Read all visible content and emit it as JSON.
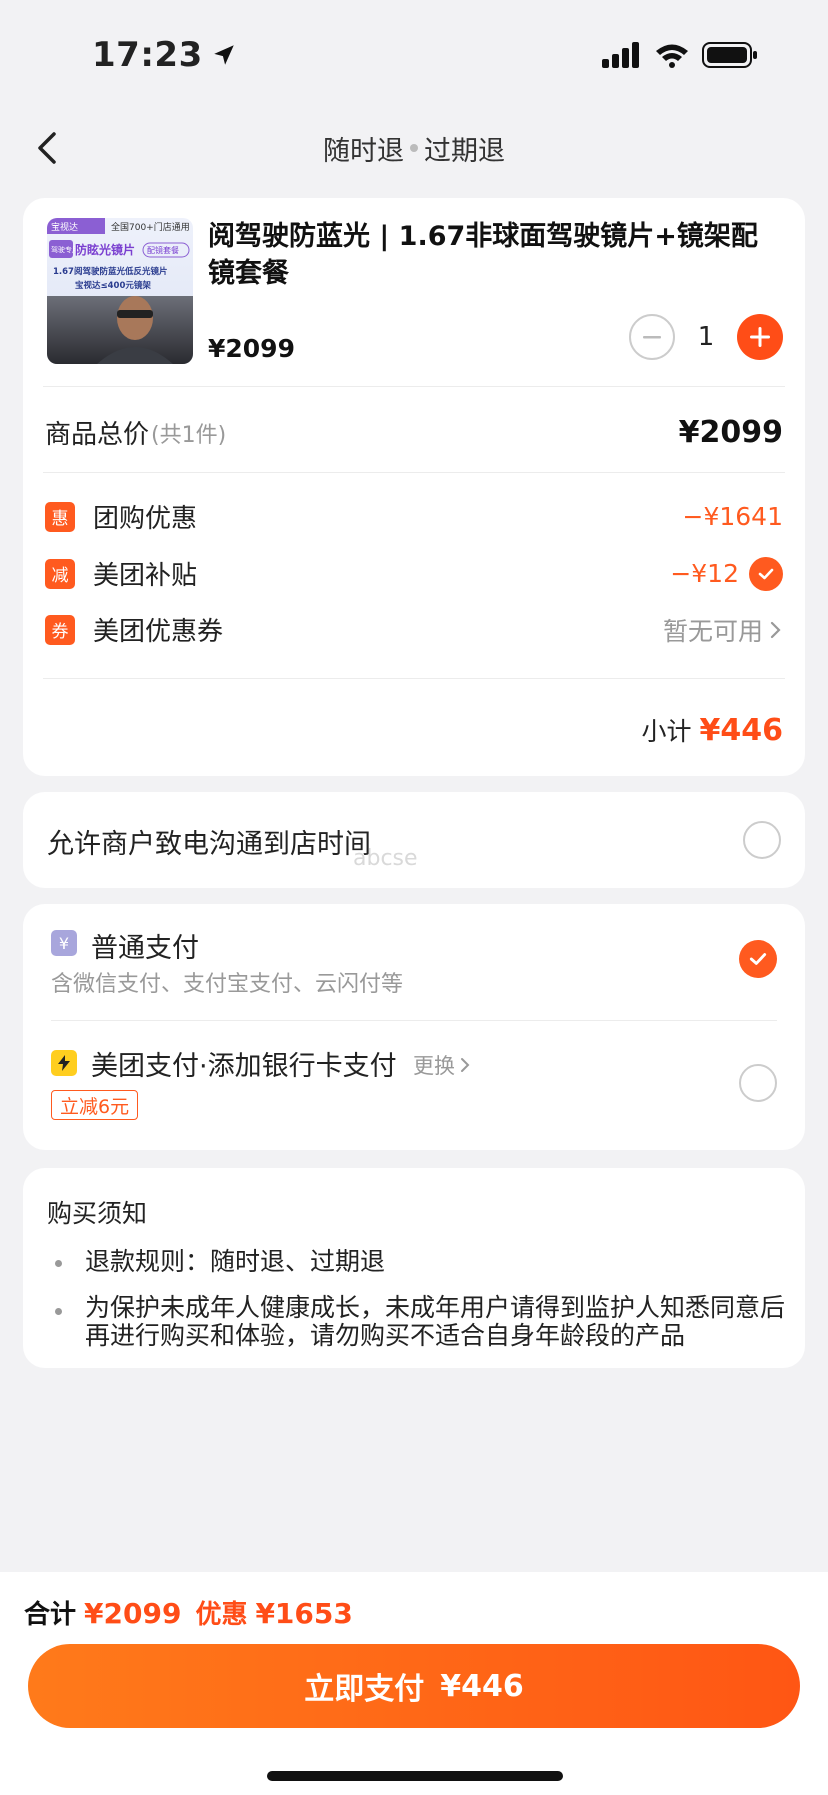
{
  "status": {
    "time": "17:23"
  },
  "nav": {
    "title_left": "随时退",
    "title_right": "过期退"
  },
  "product": {
    "thumb": {
      "badge_left": "宝视达",
      "badge_right": "全国700+门店通用",
      "tag_a": "驾驶专用",
      "tag_b": "防眩光镜片",
      "tag_c": "配镜套餐",
      "line1": "1.67阅驾驶防蓝光低反光镜片",
      "line2": "宝视达≤400元镜架"
    },
    "title": "阅驾驶防蓝光 | 1.67非球面驾驶镜片+镜架配镜套餐",
    "price": "¥2099",
    "quantity": "1"
  },
  "totals": {
    "label": "商品总价",
    "count": "(共1件)",
    "value": "¥2099"
  },
  "discounts": [
    {
      "tag": "惠",
      "label": "团购优惠",
      "value": "−¥1641"
    },
    {
      "tag": "减",
      "label": "美团补贴",
      "value": "−¥12"
    },
    {
      "tag": "券",
      "label": "美团优惠券",
      "value": "暂无可用"
    }
  ],
  "subtotal": {
    "label": "小计",
    "value": "¥446"
  },
  "contact": {
    "label": "允许商户致电沟通到店时间",
    "watermark": "abcse"
  },
  "payment": {
    "normal": {
      "icon": "¥",
      "title": "普通支付",
      "desc": "含微信支付、支付宝支付、云闪付等"
    },
    "meituan": {
      "title": "美团支付·添加银行卡支付",
      "change": "更换",
      "promo": "立减6元"
    }
  },
  "notice": {
    "title": "购买须知",
    "items": [
      "退款规则：随时退、过期退",
      "为保护未成年人健康成长，未成年用户请得到监护人知悉同意后再进行购买和体验，请勿购买不适合自身年龄段的产品"
    ]
  },
  "bottom": {
    "total_label": "合计",
    "total_value": "¥2099",
    "discount_label": "优惠",
    "discount_value": "¥1653",
    "pay_label": "立即支付",
    "pay_value": "¥446"
  },
  "colors": {
    "accent": "#ff4d17",
    "background": "#f2f2f4"
  }
}
